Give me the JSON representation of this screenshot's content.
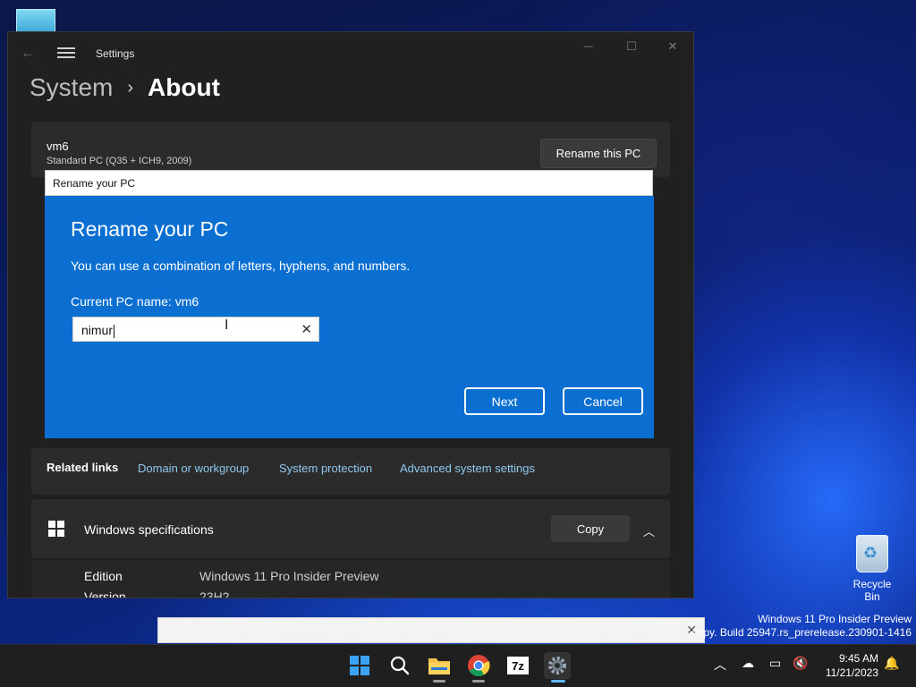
{
  "window": {
    "title": "Settings",
    "back_icon": "back-arrow-icon",
    "menu_icon": "hamburger-menu-icon",
    "controls": {
      "minimize": "─",
      "maximize": "☐",
      "close": "✕"
    }
  },
  "breadcrumb": {
    "parent": "System",
    "separator": "›",
    "current": "About"
  },
  "device": {
    "name": "vm6",
    "model": "Standard PC (Q35 + ICH9, 2009)",
    "rename_button": "Rename this PC"
  },
  "related_links": {
    "label": "Related links",
    "links": [
      "Domain or workgroup",
      "System protection",
      "Advanced system settings"
    ]
  },
  "specs": {
    "title": "Windows specifications",
    "copy_button": "Copy",
    "rows": [
      {
        "label": "Edition",
        "value": "Windows 11 Pro Insider Preview"
      },
      {
        "label": "Version",
        "value": "23H2"
      }
    ]
  },
  "dialog": {
    "window_title": "Rename your PC",
    "heading": "Rename your PC",
    "description": "You can use a combination of letters, hyphens, and numbers.",
    "current_name": "Current PC name: vm6",
    "input_value": "nimur",
    "clear_icon": "✕",
    "next_button": "Next",
    "cancel_button": "Cancel",
    "accent_color": "#0a6fd1"
  },
  "desktop": {
    "recycle_bin_label": "Recycle Bin",
    "watermark_line1": "Windows 11 Pro Insider Preview",
    "watermark_line2": "copy. Build 25947.rs_prerelease.230901-1416"
  },
  "taskbar": {
    "apps": [
      "start-icon",
      "search-icon",
      "file-explorer-icon",
      "chrome-icon",
      "7zip-icon",
      "settings-icon"
    ],
    "time": "9:45 AM",
    "date": "11/21/2023"
  }
}
